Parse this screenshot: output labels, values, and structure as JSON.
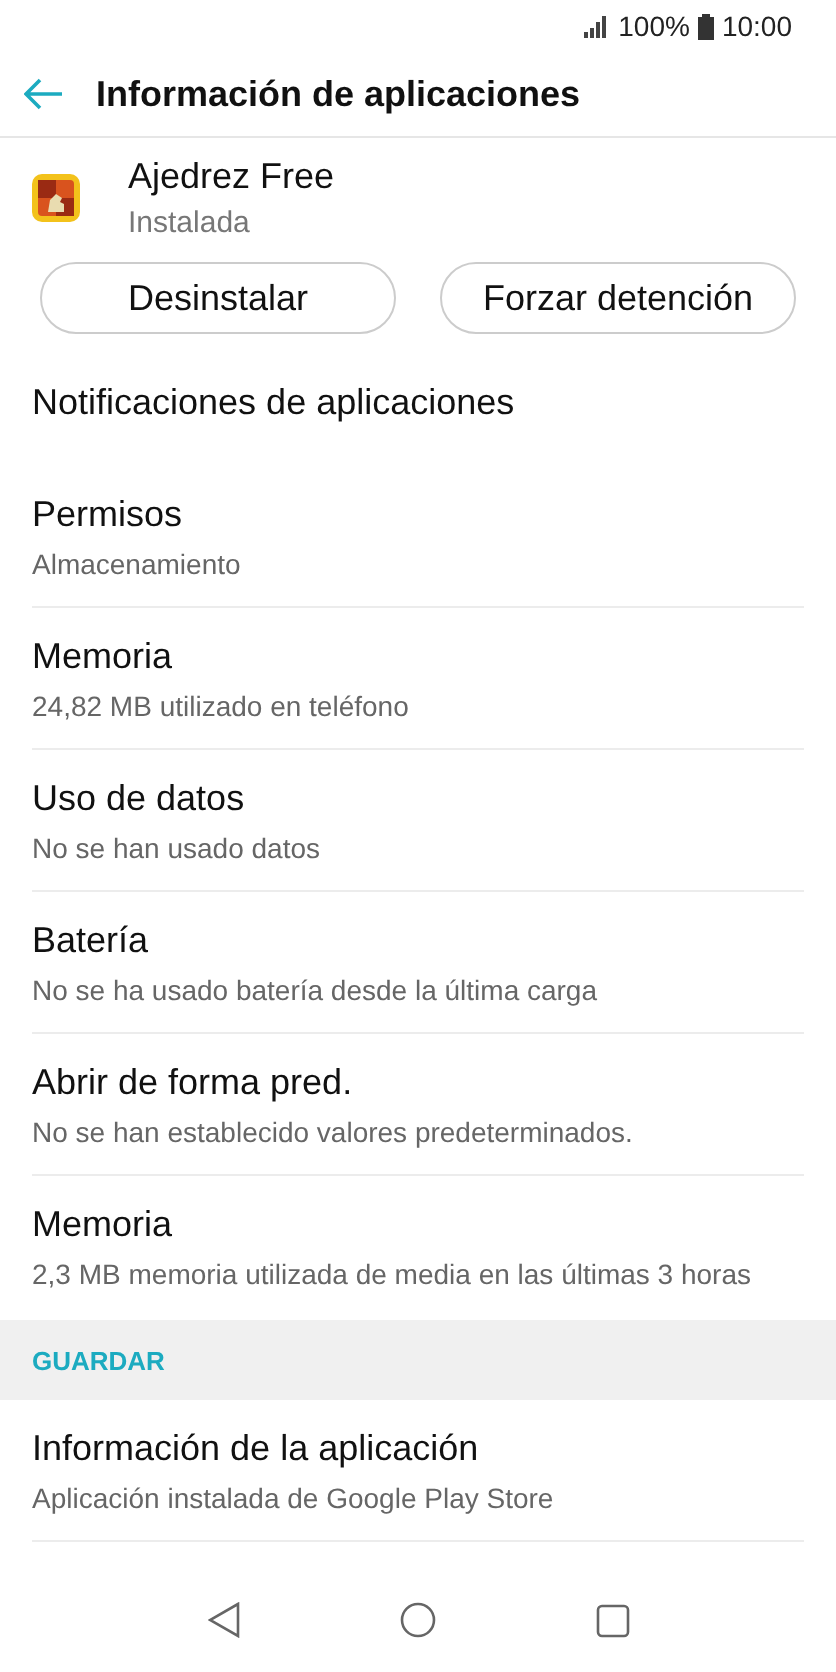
{
  "status_bar": {
    "battery": "100%",
    "time": "10:00"
  },
  "header": {
    "title": "Información de aplicaciones"
  },
  "app": {
    "name": "Ajedrez Free",
    "status": "Instalada"
  },
  "buttons": [
    "Desinstalar",
    "Forzar detención"
  ],
  "items": [
    {
      "title": "Notificaciones de aplicaciones"
    },
    {
      "title": "Permisos",
      "subtitle": "Almacenamiento"
    },
    {
      "title": "Memoria",
      "subtitle": "24,82 MB utilizado en teléfono"
    },
    {
      "title": "Uso de datos",
      "subtitle": "No se han usado datos"
    },
    {
      "title": "Batería",
      "subtitle": "No se ha usado batería desde la última carga"
    },
    {
      "title": "Abrir de forma pred.",
      "subtitle": "No se han establecido valores predeterminados."
    },
    {
      "title": "Memoria",
      "subtitle": "2,3 MB memoria utilizada de media en las últimas 3 horas"
    }
  ],
  "section": {
    "title": "GUARDAR",
    "items": [
      {
        "title": "Información de la aplicación",
        "subtitle": "Aplicación instalada de Google Play Store"
      }
    ]
  }
}
